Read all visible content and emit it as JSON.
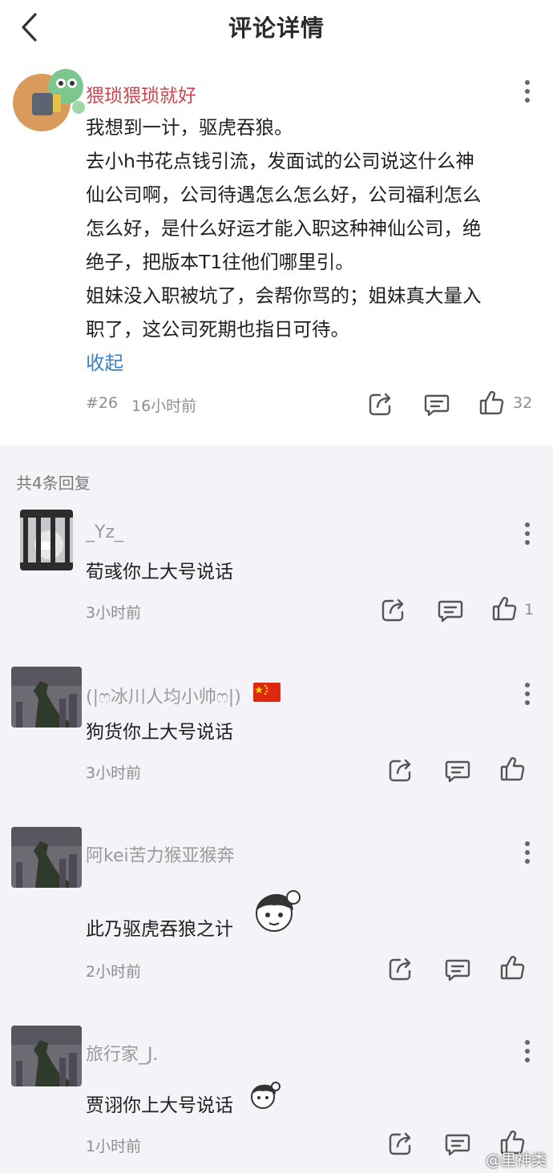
{
  "header": {
    "title": "评论详情"
  },
  "main_comment": {
    "author": "猥琐猥琐就好",
    "lines": [
      "我想到一计，驱虎吞狼。",
      "去小h书花点钱引流，发面试的公司说这什么神",
      "仙公司啊，公司待遇怎么怎么好，公司福利怎么",
      "怎么好，是什么好运才能入职这种神仙公司，绝",
      "绝子，把版本T1往他们哪里引。",
      "姐妹没入职被坑了，会帮你骂的；姐妹真大量入",
      "职了，这公司死期也指日可待。"
    ],
    "collapse_label": "收起",
    "floor": "#26",
    "time": "16小时前",
    "likes": "32"
  },
  "replies_header": "共4条回复",
  "replies": [
    {
      "author": "_Yz_",
      "text": "荀彧你上大号说话",
      "time": "3小时前",
      "likes": "1"
    },
    {
      "author": "(|ෆ冰川人均小帅ෆ|)",
      "text": "狗货你上大号说话",
      "time": "3小时前",
      "likes": ""
    },
    {
      "author": "阿kei苦力猴亚猴奔",
      "text": "此乃驱虎吞狼之计",
      "time": "2小时前",
      "likes": ""
    },
    {
      "author": "旅行家_J.",
      "text": "贾诩你上大号说话",
      "time": "1小时前",
      "likes": ""
    }
  ],
  "watermark": "@里神类",
  "colors": {
    "main_author": "#c9474f",
    "link": "#3b7fc7",
    "meta": "#8e8e8e",
    "background": "#f4f3f8"
  },
  "icons": [
    "back-chevron-icon",
    "more-dots-icon",
    "share-icon",
    "comment-icon",
    "thumbs-up-icon",
    "china-flag-icon",
    "sticker-icon"
  ]
}
